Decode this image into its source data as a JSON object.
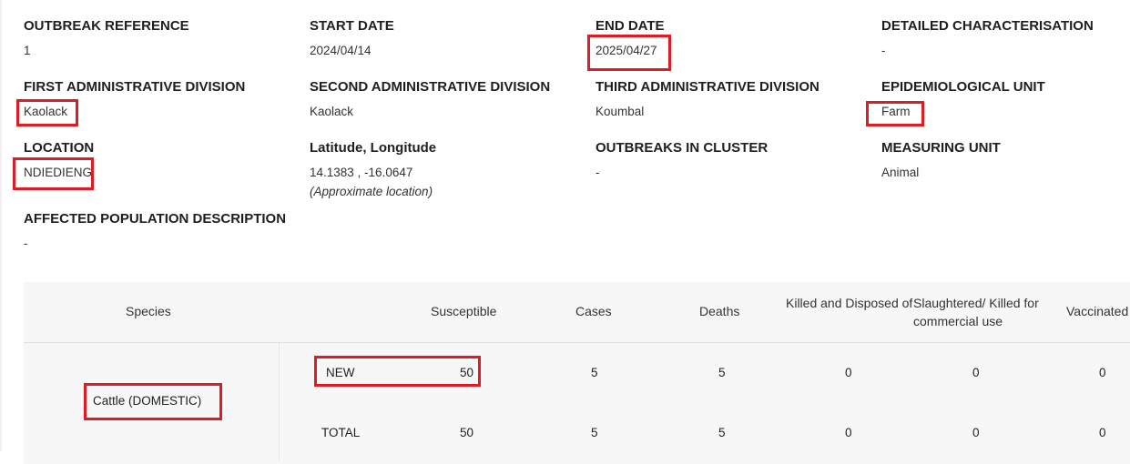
{
  "details": {
    "outbreak_reference": {
      "label": "OUTBREAK REFERENCE",
      "value": "1"
    },
    "start_date": {
      "label": "START DATE",
      "value": "2024/04/14"
    },
    "end_date": {
      "label": "END DATE",
      "value": "2025/04/27"
    },
    "detailed_characterisation": {
      "label": "DETAILED CHARACTERISATION",
      "value": "-"
    },
    "first_admin_division": {
      "label": "FIRST ADMINISTRATIVE DIVISION",
      "value": "Kaolack"
    },
    "second_admin_division": {
      "label": "SECOND ADMINISTRATIVE DIVISION",
      "value": "Kaolack"
    },
    "third_admin_division": {
      "label": "THIRD ADMINISTRATIVE DIVISION",
      "value": "Koumbal"
    },
    "epidemiological_unit": {
      "label": "EPIDEMIOLOGICAL UNIT",
      "value": "Farm"
    },
    "location": {
      "label": "LOCATION",
      "value": "NDIEDIENG"
    },
    "lat_long": {
      "label": "Latitude, Longitude",
      "value": "14.1383 , -16.0647",
      "note": "(Approximate location)"
    },
    "outbreaks_in_cluster": {
      "label": "OUTBREAKS IN CLUSTER",
      "value": "-"
    },
    "measuring_unit": {
      "label": "MEASURING UNIT",
      "value": "Animal"
    },
    "affected_population_description": {
      "label": "AFFECTED POPULATION DESCRIPTION",
      "value": "-"
    }
  },
  "table": {
    "headers": {
      "species": "Species",
      "susceptible": "Susceptible",
      "cases": "Cases",
      "deaths": "Deaths",
      "killed_disposed": "Killed and Disposed of",
      "slaughtered": "Slaughtered/ Killed for commercial use",
      "vaccinated": "Vaccinated"
    },
    "rows": [
      {
        "species": "Cattle (DOMESTIC)",
        "new": {
          "label": "NEW",
          "susceptible": "50",
          "cases": "5",
          "deaths": "5",
          "killed_disposed": "0",
          "slaughtered": "0",
          "vaccinated": "0"
        },
        "total": {
          "label": "TOTAL",
          "susceptible": "50",
          "cases": "5",
          "deaths": "5",
          "killed_disposed": "0",
          "slaughtered": "0",
          "vaccinated": "0"
        }
      }
    ]
  },
  "highlight_color": "#e01b24"
}
